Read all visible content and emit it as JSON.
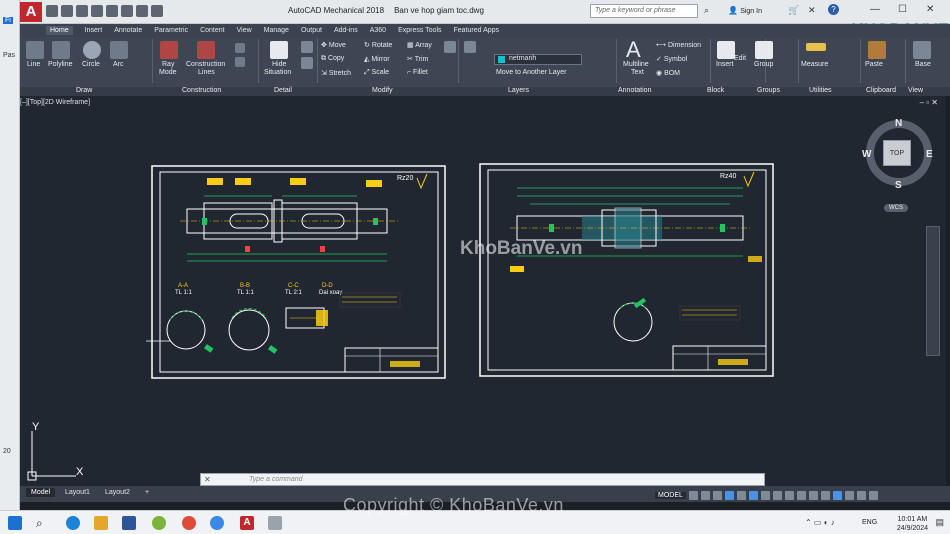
{
  "app": {
    "title": "AutoCAD Mechanical 2018",
    "filename": "Ban ve hop giam toc.dwg",
    "search_placeholder": "Type a keyword or phrase",
    "signin": "Sign In"
  },
  "left_strip": {
    "fi_label": "Fi",
    "pas_label": "Pas",
    "num_label": "20"
  },
  "tabs": [
    "Home",
    "Insert",
    "Annotate",
    "Parametric",
    "Content",
    "View",
    "Manage",
    "Output",
    "Add-ins",
    "A360",
    "Express Tools",
    "Featured Apps"
  ],
  "ribbon": {
    "draw": {
      "line": "Line",
      "polyline": "Polyline",
      "circle": "Circle",
      "arc": "Arc",
      "ray": "Ray",
      "mode": "Mode",
      "construction": "Construction",
      "lines": "Lines"
    },
    "hide_situation": [
      "Hide",
      "Situation"
    ],
    "modify": {
      "move": "Move",
      "rotate": "Rotate",
      "array": "Array",
      "copy": "Copy",
      "mirror": "Mirror",
      "trim": "Trim",
      "stretch": "Stretch",
      "scale": "Scale",
      "fillet": "Fillet"
    },
    "layers": {
      "current_layer": "netmanh",
      "move_to_layer": "Move to Another Layer"
    },
    "annotation": {
      "multiline": "Multiline",
      "text": "Text",
      "dimension": "Dimension",
      "symbol": "Symbol",
      "bom": "BOM"
    },
    "insert": "Insert",
    "edit": "Edit",
    "group": "Group",
    "measure": "Measure",
    "paste": "Paste",
    "base": "Base"
  },
  "panels": [
    "Draw",
    "Construction",
    "Detail",
    "Modify",
    "Layers",
    "Annotation",
    "Block",
    "Groups",
    "Utilities",
    "Clipboard",
    "View"
  ],
  "viewport": {
    "label": "[–][Top][2D Wireframe]"
  },
  "viewcube": {
    "n": "N",
    "s": "S",
    "e": "E",
    "w": "W",
    "top": "TOP",
    "wcs": "WCS"
  },
  "ucs": {
    "x": "X",
    "y": "Y"
  },
  "drawing": {
    "sheet1": {
      "roughness": "Rz20",
      "sections": [
        "A-A",
        "B-B",
        "C-C",
        "D-D"
      ],
      "scales": [
        "TL 1:1",
        "TL 1:1",
        "TL 2:1",
        "Dai xoay"
      ]
    },
    "sheet2": {
      "roughness": "Rz40"
    },
    "watermark": "KhoBanVe.vn"
  },
  "command": {
    "placeholder": "Type a command"
  },
  "layout_tabs": [
    "Model",
    "Layout1",
    "Layout2",
    "+"
  ],
  "status": {
    "model": "MODEL"
  },
  "taskbar": {
    "lang": "ENG",
    "time": "10:01 AM",
    "date": "24/9/2024"
  },
  "copyright": "Copyright © KhoBanVe.vn",
  "brand": "KHOBANVE",
  "colors": {
    "canvas": "#212731",
    "ribbon": "#3f4653",
    "border": "#ffffff",
    "dim": "#22c55e",
    "text": "#facc15",
    "accent": "#c0282d"
  }
}
